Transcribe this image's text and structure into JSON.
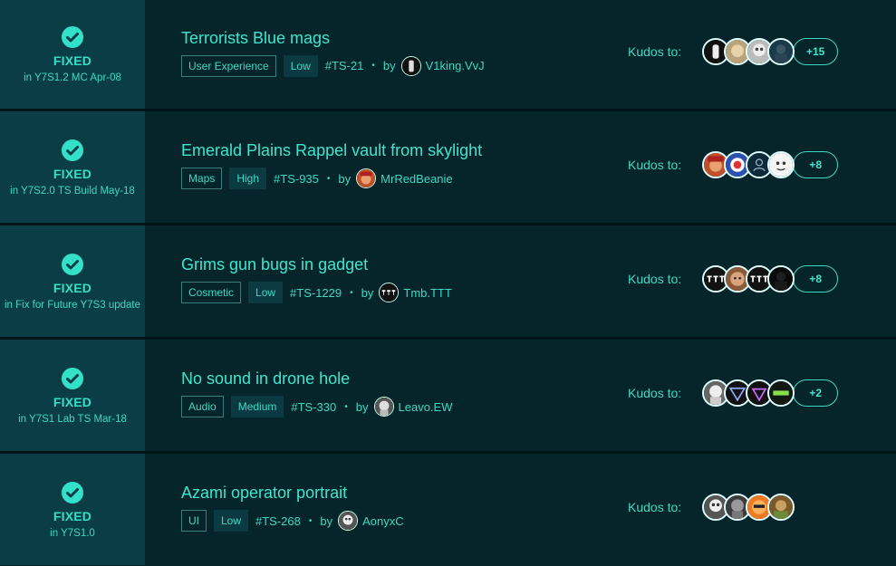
{
  "colors": {
    "accent": "#3ee6cf",
    "status_bg": "#0a3d45",
    "row_bg": "#05252a"
  },
  "kudos_label": "Kudos to:",
  "by_label": "by",
  "issues": [
    {
      "status": "FIXED",
      "version": "in Y7S1.2 MC Apr-08",
      "title": "Terrorists Blue mags",
      "category": "User Experience",
      "priority": "Low",
      "ticket": "#TS-21",
      "author": "V1king.VvJ",
      "kudos_more": "+15"
    },
    {
      "status": "FIXED",
      "version": "in Y7S2.0 TS Build May-18",
      "title": "Emerald Plains Rappel vault from skylight",
      "category": "Maps",
      "priority": "High",
      "ticket": "#TS-935",
      "author": "MrRedBeanie",
      "kudos_more": "+8"
    },
    {
      "status": "FIXED",
      "version": "in Fix for Future Y7S3 update",
      "title": "Grims gun bugs in gadget",
      "category": "Cosmetic",
      "priority": "Low",
      "ticket": "#TS-1229",
      "author": "Tmb.TTT",
      "kudos_more": "+8"
    },
    {
      "status": "FIXED",
      "version": "in Y7S1 Lab TS Mar-18",
      "title": "No sound in drone hole",
      "category": "Audio",
      "priority": "Medium",
      "ticket": "#TS-330",
      "author": "Leavo.EW",
      "kudos_more": "+2"
    },
    {
      "status": "FIXED",
      "version": "in Y7S1.0",
      "title": "Azami operator portrait",
      "category": "UI",
      "priority": "Low",
      "ticket": "#TS-268",
      "author": "AonyxC",
      "kudos_more": ""
    }
  ]
}
